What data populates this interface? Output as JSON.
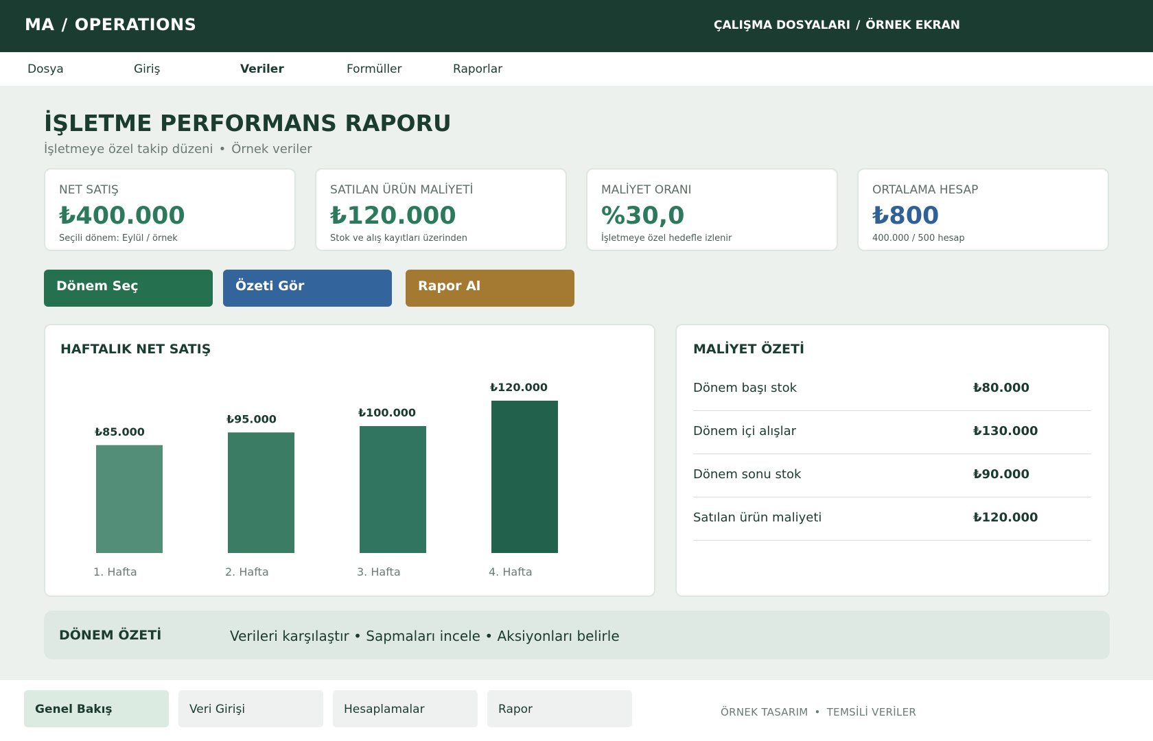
{
  "header": {
    "brand": "MA",
    "brand_section": "OPERATIONS",
    "breadcrumb_1": "ÇALIŞMA DOSYALARI",
    "breadcrumb_2": "ÖRNEK EKRAN",
    "separator": "/"
  },
  "menu": {
    "items": [
      {
        "label": "Dosya"
      },
      {
        "label": "Giriş"
      },
      {
        "label": "Veriler"
      },
      {
        "label": "Formüller"
      },
      {
        "label": "Raporlar"
      }
    ],
    "active": "Veriler"
  },
  "page": {
    "title": "İŞLETME PERFORMANS RAPORU",
    "subtitle_1": "İşletmeye özel takip düzeni",
    "subtitle_dot": "•",
    "subtitle_2": "Örnek veriler"
  },
  "kpis": [
    {
      "label": "NET SATIŞ",
      "value": "₺400.000",
      "note": "Seçili dönem: Eylül / örnek"
    },
    {
      "label": "SATILAN ÜRÜN MALİYETİ",
      "value": "₺120.000",
      "note": "Stok ve alış kayıtları üzerinden"
    },
    {
      "label": "MALİYET ORANI",
      "value": "%30,0",
      "note": "İşletmeye özel hedefle izlenir"
    },
    {
      "label": "ORTALAMA HESAP",
      "value": "₺800",
      "note": "400.000 / 500 hesap"
    }
  ],
  "actions": {
    "select_period": "Dönem Seç",
    "view_summary": "Özeti Gör",
    "get_report": "Rapor Al"
  },
  "colors": {
    "header_bg": "#1b3d31",
    "accent_green": "#2a7a5b",
    "accent_blue": "#2f6196",
    "accent_gold": "#a47a33",
    "bar_colors": [
      "#528e78",
      "#3a7d64",
      "#317561",
      "#22614c"
    ]
  },
  "chart_panel": {
    "title": "HAFTALIK NET SATIŞ"
  },
  "chart_data": {
    "type": "bar",
    "title": "HAFTALIK NET SATIŞ",
    "categories": [
      "1. Hafta",
      "2. Hafta",
      "3. Hafta",
      "4. Hafta"
    ],
    "values": [
      85000,
      95000,
      100000,
      120000
    ],
    "data_labels": [
      "₺85.000",
      "₺95.000",
      "₺100.000",
      "₺120.000"
    ],
    "ylim": [
      0,
      120000
    ],
    "grid": false,
    "legend": "none"
  },
  "cost_panel": {
    "title": "MALİYET ÖZETİ",
    "rows": [
      {
        "label": "Dönem başı stok",
        "value": "₺80.000"
      },
      {
        "label": "Dönem içi alışlar",
        "value": "₺130.000"
      },
      {
        "label": "Dönem sonu stok",
        "value": "₺90.000"
      },
      {
        "label": "Satılan ürün maliyeti",
        "value": "₺120.000"
      }
    ]
  },
  "summary": {
    "title": "DÖNEM ÖZETİ",
    "text": "Verileri karşılaştır • Sapmaları incele • Aksiyonları belirle"
  },
  "bottom_tabs": [
    {
      "label": "Genel Bakış"
    },
    {
      "label": "Veri Girişi"
    },
    {
      "label": "Hesaplamalar"
    },
    {
      "label": "Rapor"
    }
  ],
  "footer": {
    "note_1": "ÖRNEK TASARIM",
    "note_dot": "•",
    "note_2": "TEMSİLİ VERİLER"
  }
}
